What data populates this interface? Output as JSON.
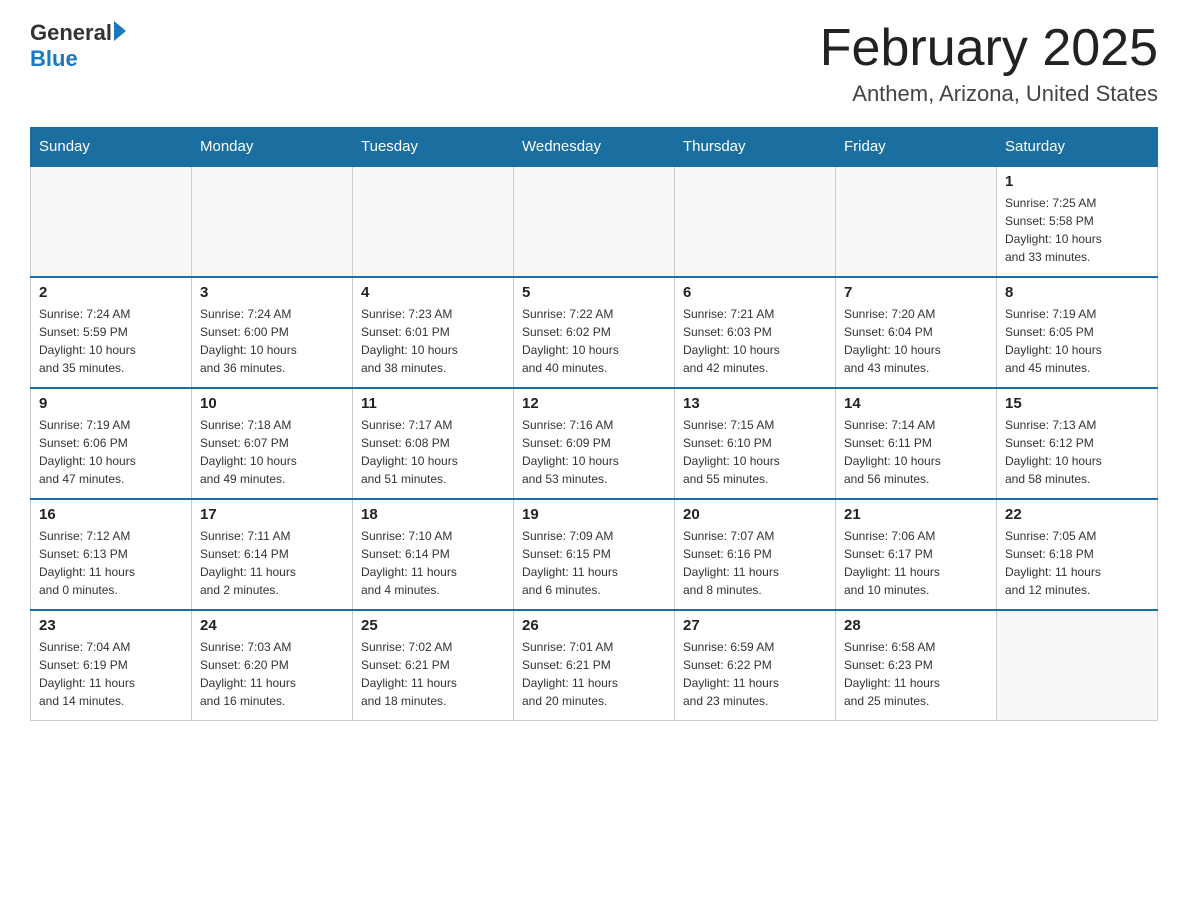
{
  "header": {
    "logo_general": "General",
    "logo_blue": "Blue",
    "month_title": "February 2025",
    "location": "Anthem, Arizona, United States"
  },
  "weekdays": [
    "Sunday",
    "Monday",
    "Tuesday",
    "Wednesday",
    "Thursday",
    "Friday",
    "Saturday"
  ],
  "weeks": [
    [
      {
        "day": "",
        "info": ""
      },
      {
        "day": "",
        "info": ""
      },
      {
        "day": "",
        "info": ""
      },
      {
        "day": "",
        "info": ""
      },
      {
        "day": "",
        "info": ""
      },
      {
        "day": "",
        "info": ""
      },
      {
        "day": "1",
        "info": "Sunrise: 7:25 AM\nSunset: 5:58 PM\nDaylight: 10 hours\nand 33 minutes."
      }
    ],
    [
      {
        "day": "2",
        "info": "Sunrise: 7:24 AM\nSunset: 5:59 PM\nDaylight: 10 hours\nand 35 minutes."
      },
      {
        "day": "3",
        "info": "Sunrise: 7:24 AM\nSunset: 6:00 PM\nDaylight: 10 hours\nand 36 minutes."
      },
      {
        "day": "4",
        "info": "Sunrise: 7:23 AM\nSunset: 6:01 PM\nDaylight: 10 hours\nand 38 minutes."
      },
      {
        "day": "5",
        "info": "Sunrise: 7:22 AM\nSunset: 6:02 PM\nDaylight: 10 hours\nand 40 minutes."
      },
      {
        "day": "6",
        "info": "Sunrise: 7:21 AM\nSunset: 6:03 PM\nDaylight: 10 hours\nand 42 minutes."
      },
      {
        "day": "7",
        "info": "Sunrise: 7:20 AM\nSunset: 6:04 PM\nDaylight: 10 hours\nand 43 minutes."
      },
      {
        "day": "8",
        "info": "Sunrise: 7:19 AM\nSunset: 6:05 PM\nDaylight: 10 hours\nand 45 minutes."
      }
    ],
    [
      {
        "day": "9",
        "info": "Sunrise: 7:19 AM\nSunset: 6:06 PM\nDaylight: 10 hours\nand 47 minutes."
      },
      {
        "day": "10",
        "info": "Sunrise: 7:18 AM\nSunset: 6:07 PM\nDaylight: 10 hours\nand 49 minutes."
      },
      {
        "day": "11",
        "info": "Sunrise: 7:17 AM\nSunset: 6:08 PM\nDaylight: 10 hours\nand 51 minutes."
      },
      {
        "day": "12",
        "info": "Sunrise: 7:16 AM\nSunset: 6:09 PM\nDaylight: 10 hours\nand 53 minutes."
      },
      {
        "day": "13",
        "info": "Sunrise: 7:15 AM\nSunset: 6:10 PM\nDaylight: 10 hours\nand 55 minutes."
      },
      {
        "day": "14",
        "info": "Sunrise: 7:14 AM\nSunset: 6:11 PM\nDaylight: 10 hours\nand 56 minutes."
      },
      {
        "day": "15",
        "info": "Sunrise: 7:13 AM\nSunset: 6:12 PM\nDaylight: 10 hours\nand 58 minutes."
      }
    ],
    [
      {
        "day": "16",
        "info": "Sunrise: 7:12 AM\nSunset: 6:13 PM\nDaylight: 11 hours\nand 0 minutes."
      },
      {
        "day": "17",
        "info": "Sunrise: 7:11 AM\nSunset: 6:14 PM\nDaylight: 11 hours\nand 2 minutes."
      },
      {
        "day": "18",
        "info": "Sunrise: 7:10 AM\nSunset: 6:14 PM\nDaylight: 11 hours\nand 4 minutes."
      },
      {
        "day": "19",
        "info": "Sunrise: 7:09 AM\nSunset: 6:15 PM\nDaylight: 11 hours\nand 6 minutes."
      },
      {
        "day": "20",
        "info": "Sunrise: 7:07 AM\nSunset: 6:16 PM\nDaylight: 11 hours\nand 8 minutes."
      },
      {
        "day": "21",
        "info": "Sunrise: 7:06 AM\nSunset: 6:17 PM\nDaylight: 11 hours\nand 10 minutes."
      },
      {
        "day": "22",
        "info": "Sunrise: 7:05 AM\nSunset: 6:18 PM\nDaylight: 11 hours\nand 12 minutes."
      }
    ],
    [
      {
        "day": "23",
        "info": "Sunrise: 7:04 AM\nSunset: 6:19 PM\nDaylight: 11 hours\nand 14 minutes."
      },
      {
        "day": "24",
        "info": "Sunrise: 7:03 AM\nSunset: 6:20 PM\nDaylight: 11 hours\nand 16 minutes."
      },
      {
        "day": "25",
        "info": "Sunrise: 7:02 AM\nSunset: 6:21 PM\nDaylight: 11 hours\nand 18 minutes."
      },
      {
        "day": "26",
        "info": "Sunrise: 7:01 AM\nSunset: 6:21 PM\nDaylight: 11 hours\nand 20 minutes."
      },
      {
        "day": "27",
        "info": "Sunrise: 6:59 AM\nSunset: 6:22 PM\nDaylight: 11 hours\nand 23 minutes."
      },
      {
        "day": "28",
        "info": "Sunrise: 6:58 AM\nSunset: 6:23 PM\nDaylight: 11 hours\nand 25 minutes."
      },
      {
        "day": "",
        "info": ""
      }
    ]
  ]
}
